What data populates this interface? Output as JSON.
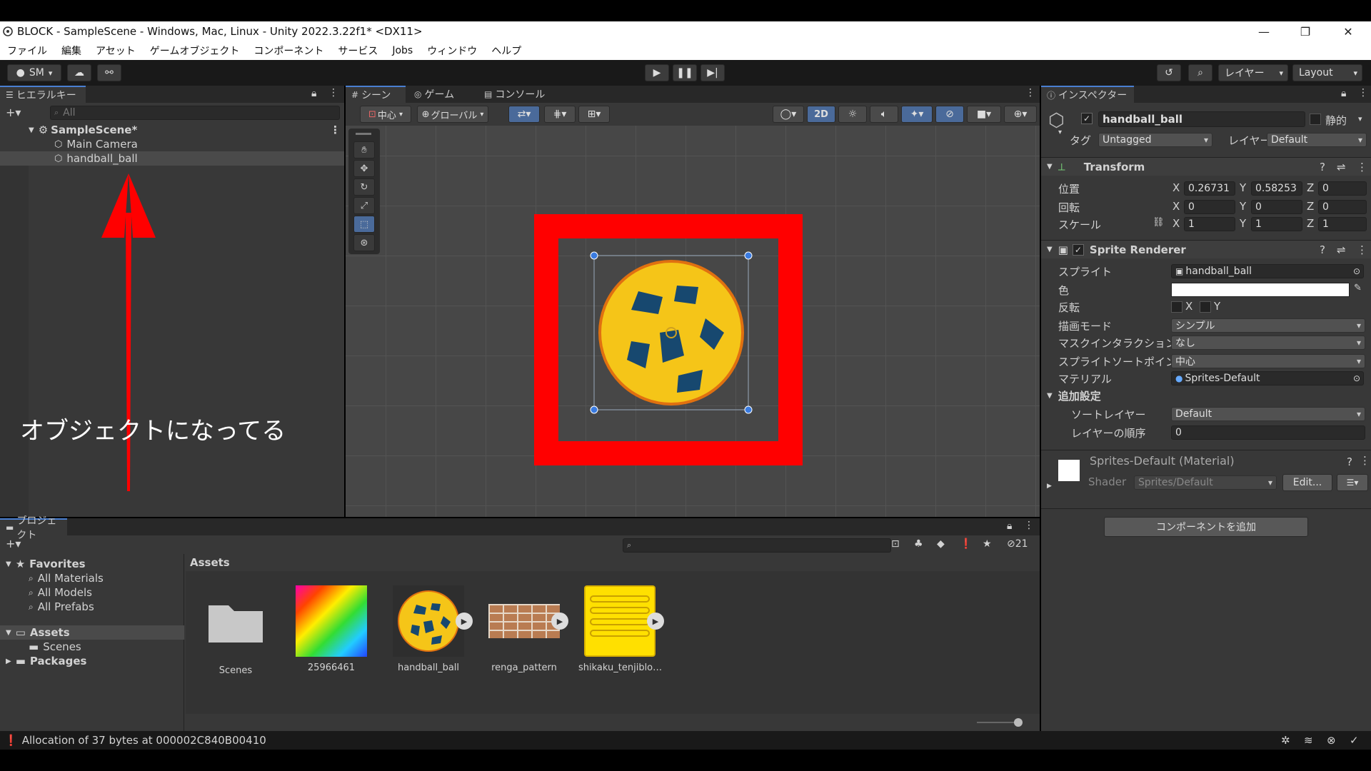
{
  "window": {
    "title": "BLOCK - SampleScene - Windows, Mac, Linux - Unity 2022.3.22f1* <DX11>",
    "minimize": "—",
    "maximize": "❐",
    "close": "✕"
  },
  "menu": [
    "ファイル",
    "編集",
    "アセット",
    "ゲームオブジェクト",
    "コンポーネント",
    "サービス",
    "Jobs",
    "ウィンドウ",
    "ヘルプ"
  ],
  "toolbar": {
    "account": "SM",
    "layers": "レイヤー",
    "layout": "Layout"
  },
  "hierarchy": {
    "tab": "ヒエラルキー",
    "search_placeholder": "All",
    "scene": "SampleScene*",
    "items": [
      "Main Camera",
      "handball_ball"
    ]
  },
  "annotation": {
    "text": "オブジェクトになってる",
    "color": "#ff0000"
  },
  "scene_view": {
    "tabs": [
      "シーン",
      "ゲーム",
      "コンソール"
    ],
    "pivot": "中心",
    "space": "グローバル",
    "mode_2d": "2D"
  },
  "inspector": {
    "tab": "インスペクター",
    "object_name": "handball_ball",
    "static_label": "静的",
    "tag_label": "タグ",
    "tag_value": "Untagged",
    "layer_label": "レイヤー",
    "layer_value": "Default",
    "transform": {
      "title": "Transform",
      "position_label": "位置",
      "rotation_label": "回転",
      "scale_label": "スケール",
      "position": {
        "x": "0.26731",
        "y": "0.58253",
        "z": "0"
      },
      "rotation": {
        "x": "0",
        "y": "0",
        "z": "0"
      },
      "scale": {
        "x": "1",
        "y": "1",
        "z": "1"
      }
    },
    "sprite_renderer": {
      "title": "Sprite Renderer",
      "sprite_label": "スプライト",
      "sprite_value": "handball_ball",
      "color_label": "色",
      "flip_label": "反転",
      "flip_x": "X",
      "flip_y": "Y",
      "draw_mode_label": "描画モード",
      "draw_mode_value": "シンプル",
      "mask_label": "マスクインタラクション",
      "mask_value": "なし",
      "sort_point_label": "スプライトソートポイント",
      "sort_point_value": "中心",
      "material_label": "マテリアル",
      "material_value": "Sprites-Default",
      "additional_label": "追加設定",
      "sorting_layer_label": "ソートレイヤー",
      "sorting_layer_value": "Default",
      "order_label": "レイヤーの順序",
      "order_value": "0"
    },
    "material": {
      "title": "Sprites-Default (Material)",
      "shader_label": "Shader",
      "shader_value": "Sprites/Default",
      "edit_button": "Edit..."
    },
    "add_component": "コンポーネントを追加"
  },
  "project": {
    "tab": "プロジェクト",
    "favorites_label": "Favorites",
    "favorites": [
      "All Materials",
      "All Models",
      "All Prefabs"
    ],
    "assets_label": "Assets",
    "asset_subfolders": [
      "Scenes"
    ],
    "packages_label": "Packages",
    "breadcrumb": "Assets",
    "hidden_count": "21",
    "assets": [
      "Scenes",
      "25966461",
      "handball_ball",
      "renga_pattern",
      "shikaku_tenjiblo…"
    ]
  },
  "status": {
    "message": "Allocation of 37 bytes at 000002C840B00410"
  }
}
